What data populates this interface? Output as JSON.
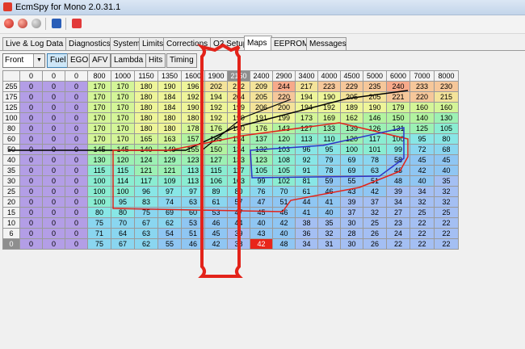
{
  "window": {
    "title": "EcmSpy for Mono 2.0.31.1"
  },
  "toolbar": {
    "icons": [
      "connect-icon",
      "disconnect-icon",
      "stop-icon",
      "help-icon",
      "record-icon"
    ]
  },
  "tabs": [
    {
      "label": "Live & Log Data",
      "name": "tab-live-log-data"
    },
    {
      "label": "Diagnostics",
      "name": "tab-diagnostics"
    },
    {
      "label": "System",
      "name": "tab-system"
    },
    {
      "label": "Limits",
      "name": "tab-limits"
    },
    {
      "label": "Corrections",
      "name": "tab-corrections"
    },
    {
      "label": "O2 Setup",
      "name": "tab-o2-setup"
    },
    {
      "label": "Maps",
      "name": "tab-maps",
      "active": true
    },
    {
      "label": "EEPROM",
      "name": "tab-eeprom"
    },
    {
      "label": "Messages",
      "name": "tab-messages"
    }
  ],
  "controls": {
    "cylinder": "Front",
    "buttons": [
      {
        "label": "Fuel",
        "active": true
      },
      {
        "label": "EGO"
      },
      {
        "label": "AFV"
      },
      {
        "label": "Lambda"
      },
      {
        "label": "Hits"
      },
      {
        "label": "Timing"
      }
    ]
  },
  "map": {
    "selected_rpm_index": 9,
    "selected_load_index": 18,
    "rpm": [
      "0",
      "0",
      "0",
      "800",
      "1000",
      "1150",
      "1350",
      "1600",
      "1900",
      "2150",
      "2400",
      "2900",
      "3400",
      "4000",
      "4500",
      "5000",
      "6000",
      "7000",
      "8000"
    ],
    "rows": [
      {
        "load": "255",
        "v": [
          "0",
          "0",
          "0",
          "170",
          "170",
          "180",
          "190",
          "196",
          "202",
          "212",
          "209",
          "244",
          "217",
          "223",
          "229",
          "235",
          "240",
          "233",
          "230"
        ]
      },
      {
        "load": "175",
        "v": [
          "0",
          "0",
          "0",
          "170",
          "170",
          "180",
          "184",
          "192",
          "194",
          "204",
          "205",
          "220",
          "194",
          "190",
          "205",
          "205",
          "221",
          "220",
          "215"
        ]
      },
      {
        "load": "125",
        "v": [
          "0",
          "0",
          "0",
          "170",
          "170",
          "180",
          "184",
          "190",
          "192",
          "199",
          "206",
          "200",
          "194",
          "192",
          "189",
          "190",
          "179",
          "160",
          "160"
        ]
      },
      {
        "load": "100",
        "v": [
          "0",
          "0",
          "0",
          "170",
          "170",
          "180",
          "180",
          "180",
          "192",
          "199",
          "191",
          "199",
          "173",
          "169",
          "162",
          "146",
          "150",
          "140",
          "130"
        ]
      },
      {
        "load": "80",
        "v": [
          "0",
          "0",
          "0",
          "170",
          "170",
          "180",
          "180",
          "178",
          "176",
          "180",
          "176",
          "143",
          "127",
          "133",
          "139",
          "126",
          "131",
          "125",
          "105"
        ]
      },
      {
        "load": "60",
        "v": [
          "0",
          "0",
          "0",
          "170",
          "170",
          "165",
          "163",
          "157",
          "155",
          "154",
          "137",
          "120",
          "113",
          "110",
          "120",
          "117",
          "100",
          "95",
          "80"
        ]
      },
      {
        "load": "50",
        "v": [
          "0",
          "0",
          "0",
          "145",
          "145",
          "140",
          "149",
          "155",
          "150",
          "134",
          "132",
          "103",
          "96",
          "95",
          "100",
          "101",
          "99",
          "72",
          "68"
        ]
      },
      {
        "load": "40",
        "v": [
          "0",
          "0",
          "0",
          "130",
          "120",
          "124",
          "129",
          "123",
          "127",
          "133",
          "123",
          "108",
          "92",
          "79",
          "69",
          "78",
          "58",
          "45",
          "45"
        ]
      },
      {
        "load": "35",
        "v": [
          "0",
          "0",
          "0",
          "115",
          "115",
          "121",
          "121",
          "113",
          "115",
          "117",
          "105",
          "105",
          "91",
          "78",
          "69",
          "63",
          "48",
          "42",
          "40"
        ]
      },
      {
        "load": "30",
        "v": [
          "0",
          "0",
          "0",
          "100",
          "114",
          "117",
          "109",
          "113",
          "106",
          "103",
          "99",
          "102",
          "81",
          "59",
          "55",
          "51",
          "48",
          "40",
          "35"
        ]
      },
      {
        "load": "25",
        "v": [
          "0",
          "0",
          "0",
          "100",
          "100",
          "96",
          "97",
          "97",
          "89",
          "80",
          "76",
          "70",
          "61",
          "46",
          "43",
          "42",
          "39",
          "34",
          "32"
        ]
      },
      {
        "load": "20",
        "v": [
          "0",
          "0",
          "0",
          "100",
          "95",
          "83",
          "74",
          "63",
          "61",
          "57",
          "47",
          "51",
          "44",
          "41",
          "39",
          "37",
          "34",
          "32",
          "32"
        ]
      },
      {
        "load": "15",
        "v": [
          "0",
          "0",
          "0",
          "80",
          "80",
          "75",
          "69",
          "60",
          "53",
          "47",
          "45",
          "46",
          "41",
          "40",
          "37",
          "32",
          "27",
          "25",
          "25"
        ]
      },
      {
        "load": "10",
        "v": [
          "0",
          "0",
          "0",
          "75",
          "70",
          "67",
          "62",
          "53",
          "46",
          "44",
          "40",
          "42",
          "38",
          "35",
          "30",
          "25",
          "23",
          "22",
          "22"
        ]
      },
      {
        "load": "6",
        "v": [
          "0",
          "0",
          "0",
          "71",
          "64",
          "63",
          "54",
          "51",
          "45",
          "39",
          "43",
          "40",
          "36",
          "32",
          "28",
          "26",
          "24",
          "22",
          "22"
        ]
      },
      {
        "load": "0",
        "v": [
          "0",
          "0",
          "0",
          "75",
          "67",
          "62",
          "55",
          "46",
          "42",
          "38",
          "42",
          "48",
          "34",
          "31",
          "30",
          "26",
          "22",
          "22",
          "22"
        ]
      }
    ]
  }
}
